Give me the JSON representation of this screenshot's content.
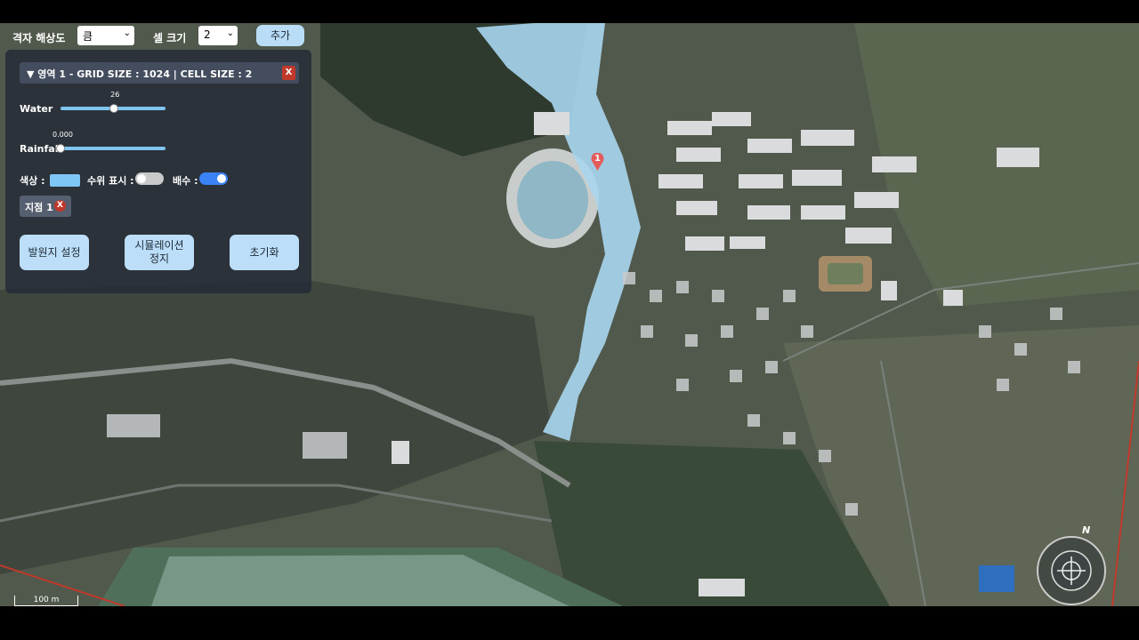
{
  "toolbar": {
    "grid_resolution_label": "격자 해상도",
    "grid_resolution_value": "큼",
    "cell_size_label": "셀 크기",
    "cell_size_value": "2",
    "add_label": "추가"
  },
  "panel": {
    "header": "▼ 영역 1 - GRID SIZE : 1024 | CELL SIZE : 2",
    "close": "X",
    "water_label": "Water",
    "water_value": "26",
    "water_level": 0.51,
    "rainfall_label": "Rainfall",
    "rainfall_value": "0.000",
    "rainfall_level": 0.0,
    "color_label": "색상 :",
    "color_value": "#7ec6f5",
    "water_level_display_label": "수위 표시 :",
    "water_level_display_on": false,
    "drainage_label": "배수 :",
    "drainage_on": true,
    "point_chip": "지점 1",
    "point_chip_close": "X",
    "buttons": [
      "발원지 설정",
      "시뮬레이션\n정지",
      "초기화"
    ]
  },
  "map": {
    "marker_label": "1",
    "scale_label": "100 m",
    "compass_north": "N"
  },
  "colors": {
    "flood_water": "#a9d6f0",
    "panel_bg": "#262c38",
    "button_bg": "#bcdef8",
    "close_red": "#c0392b",
    "toggle_on": "#3b82f6"
  }
}
